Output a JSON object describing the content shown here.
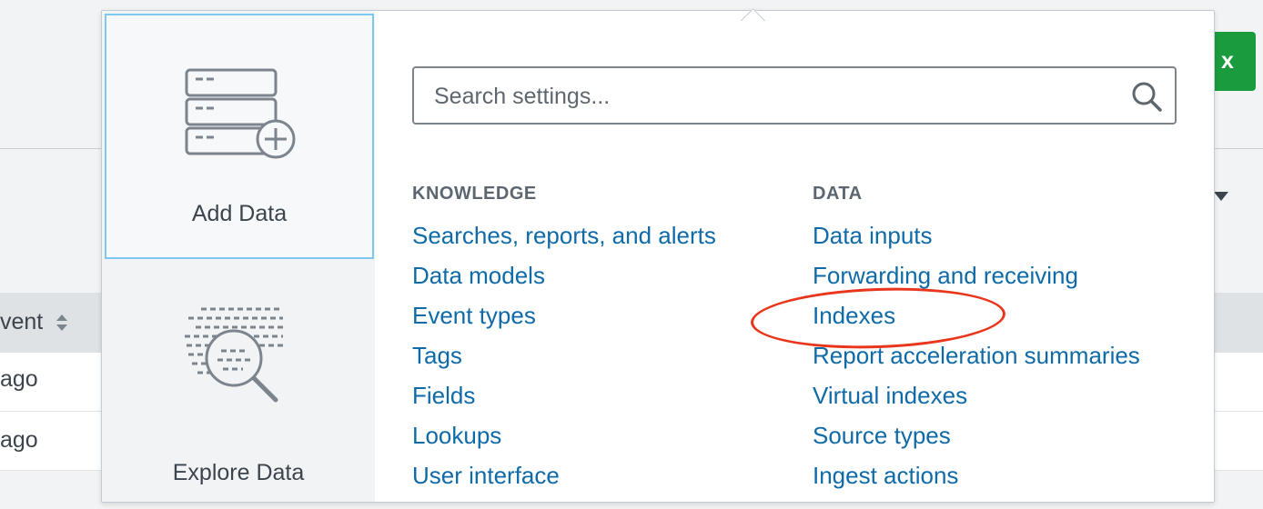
{
  "background": {
    "header_button_label": "x",
    "column_header": "vent",
    "rows": [
      "ago",
      "ago"
    ]
  },
  "menu": {
    "tiles": [
      {
        "label": "Add Data"
      },
      {
        "label": "Explore Data"
      }
    ],
    "search": {
      "placeholder": "Search settings..."
    },
    "knowledge": {
      "heading": "KNOWLEDGE",
      "links": [
        "Searches, reports, and alerts",
        "Data models",
        "Event types",
        "Tags",
        "Fields",
        "Lookups",
        "User interface"
      ]
    },
    "data": {
      "heading": "DATA",
      "links": [
        "Data inputs",
        "Forwarding and receiving",
        "Indexes",
        "Report acceleration summaries",
        "Virtual indexes",
        "Source types",
        "Ingest actions"
      ]
    }
  },
  "colors": {
    "link": "#0f6aa8",
    "annotation": "#e8361c",
    "selected_border": "#7ec8f0",
    "action_green": "#1a9c3e"
  }
}
